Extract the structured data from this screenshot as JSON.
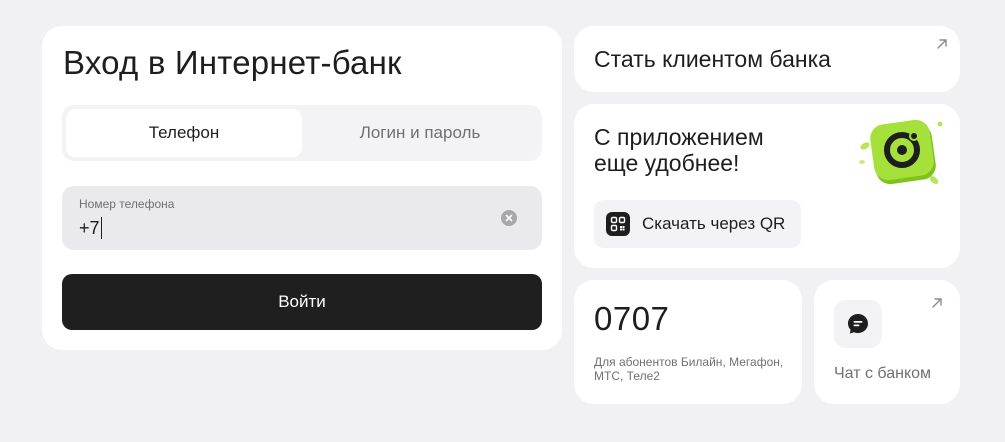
{
  "login": {
    "title": "Вход в Интернет-банк",
    "tabs": [
      {
        "label": "Телефон",
        "active": true
      },
      {
        "label": "Логин и пароль",
        "active": false
      }
    ],
    "phone_field": {
      "label": "Номер телефона",
      "value": "+7"
    },
    "submit_label": "Войти"
  },
  "become_client": {
    "title": "Стать клиентом банка",
    "icon": "arrow-up-right-icon"
  },
  "app_promo": {
    "title": "С приложением еще удобнее!",
    "qr_button_label": "Скачать через QR",
    "logo_icon": "app-logo-icon"
  },
  "short_number": {
    "number": "0707",
    "description": "Для абонентов Билайн, Мегафон, МТС, Теле2"
  },
  "chat": {
    "label": "Чат с банком",
    "icon": "chat-icon"
  },
  "colors": {
    "background": "#f1f1f4",
    "card": "#ffffff",
    "primary_button": "#1f1f1f",
    "accent_green": "#a6e03a",
    "muted_text": "#6f6f75"
  }
}
